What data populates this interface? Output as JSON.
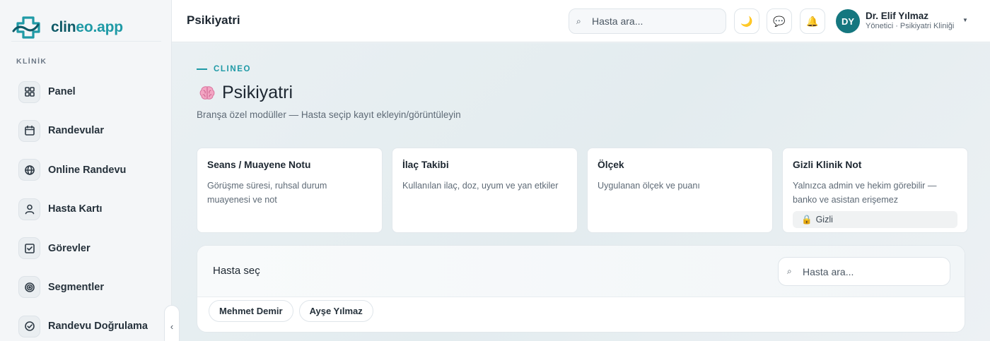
{
  "brand": {
    "name_part1": "clin",
    "name_part2": "eo.app",
    "accent_color": "#1f9aa6",
    "primary_color": "#0f5a67"
  },
  "sidebar": {
    "section_label": "KLİNİK",
    "items": [
      {
        "label": "Panel",
        "icon": "grid-icon"
      },
      {
        "label": "Randevular",
        "icon": "calendar-icon"
      },
      {
        "label": "Online Randevu",
        "icon": "globe-icon"
      },
      {
        "label": "Hasta Kartı",
        "icon": "user-icon"
      },
      {
        "label": "Görevler",
        "icon": "checkbox-icon"
      },
      {
        "label": "Segmentler",
        "icon": "target-icon"
      },
      {
        "label": "Randevu Doğrulama",
        "icon": "check-circle-icon"
      }
    ],
    "collapse_glyph": "‹"
  },
  "topbar": {
    "title": "Psikiyatri",
    "search_placeholder": "Hasta ara...",
    "user": {
      "initials": "DY",
      "name": "Dr. Elif Yılmaz",
      "role": "Yönetici · Psikiyatri Kliniği"
    }
  },
  "main": {
    "eyebrow": "CLINEO",
    "title": "Psikiyatri",
    "subtitle": "Branşa özel modüller — Hasta seçip kayıt ekleyin/görüntüleyin",
    "cards": [
      {
        "title": "Seans / Muayene Notu",
        "desc": "Görüşme süresi, ruhsal durum muayenesi ve not"
      },
      {
        "title": "İlaç Takibi",
        "desc": "Kullanılan ilaç, doz, uyum ve yan etkiler"
      },
      {
        "title": "Ölçek",
        "desc": "Uygulanan ölçek ve puanı"
      },
      {
        "title": "Gizli Klinik Not",
        "desc": "Yalnızca admin ve hekim görebilir — banko ve asistan erişemez",
        "badge": "Gizli"
      }
    ],
    "picker": {
      "title": "Hasta seç",
      "search_placeholder": "Hasta ara...",
      "patients": [
        "Mehmet Demir",
        "Ayşe Yılmaz"
      ]
    }
  }
}
